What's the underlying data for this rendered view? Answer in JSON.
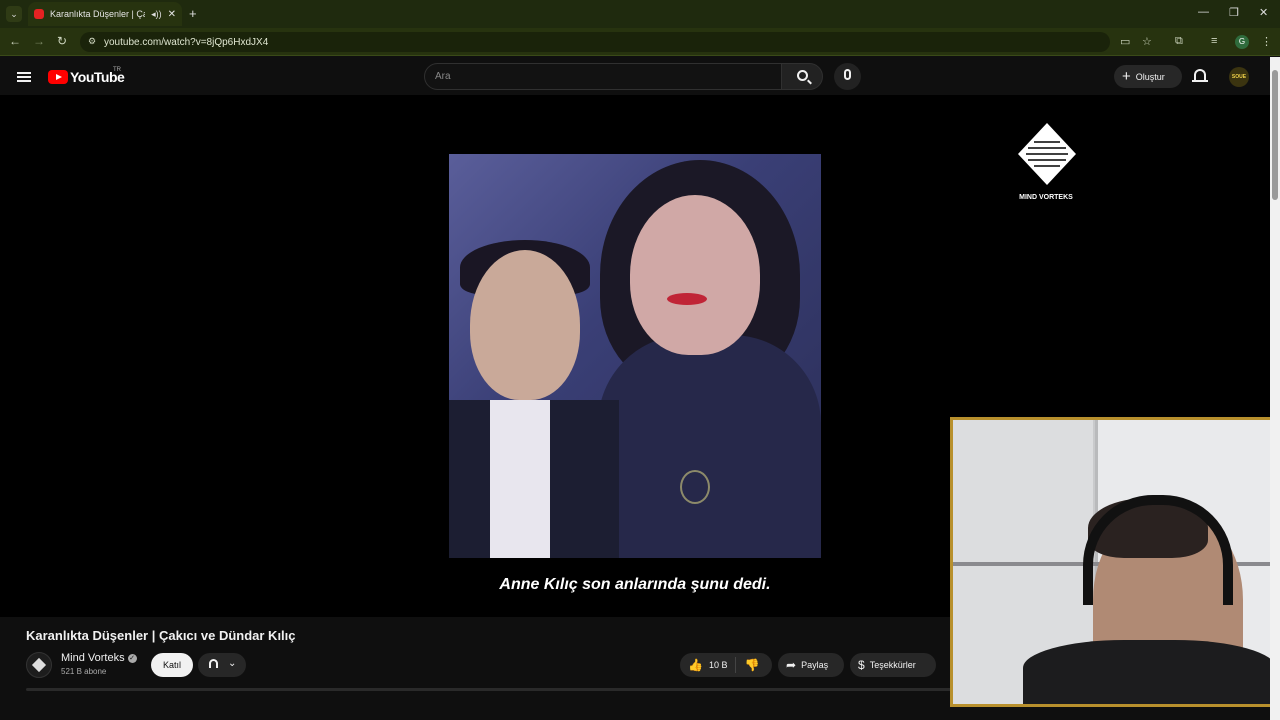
{
  "browser": {
    "tab_title": "Karanlıkta Düşenler | Çakıcı",
    "tab_close": "✕",
    "new_tab": "+",
    "url": "youtube.com/watch?v=8jQp6HxdJX4",
    "window_controls": [
      "—",
      "❐",
      "✕"
    ],
    "profile_initial": "G"
  },
  "youtube": {
    "logo_text": "YouTube",
    "country_code": "TR",
    "search_placeholder": "Ara",
    "create_label": "Oluştur",
    "avatar_text": "SOUE"
  },
  "video": {
    "subtitle": "Anne Kılıç son anlarında şunu dedi.",
    "channel_logo_text": "MIND VORTEKS",
    "title": "Karanlıkta Düşenler | Çakıcı ve Dündar Kılıç",
    "channel_name": "Mind Vorteks",
    "subscribers": "521 B abone",
    "join_label": "Katıl",
    "likes": "10 B",
    "share_label": "Paylaş",
    "thanks_label": "Teşekkürler"
  },
  "icons": {
    "back": "←",
    "forward": "→",
    "reload": "↻",
    "speaker": "🔊",
    "like": "👍",
    "dislike": "👎",
    "share": "➦",
    "thanks": "$"
  }
}
